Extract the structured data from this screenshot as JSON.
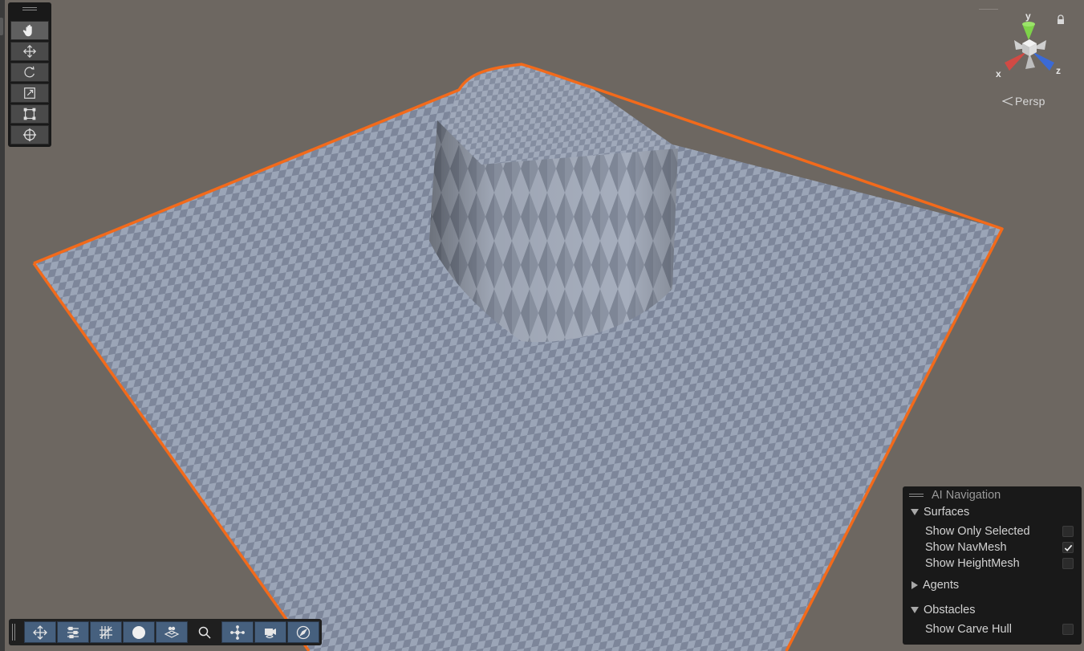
{
  "scene": {
    "view_mode": "Persp",
    "axis_labels": {
      "x": "x",
      "y": "y",
      "z": "z"
    }
  },
  "tools_toolbar": {
    "tools": [
      {
        "name": "view-tool",
        "icon": "hand-icon",
        "active": true
      },
      {
        "name": "move-tool",
        "icon": "move-icon"
      },
      {
        "name": "rotate-tool",
        "icon": "rotate-icon"
      },
      {
        "name": "scale-tool",
        "icon": "scale-icon"
      },
      {
        "name": "rect-tool",
        "icon": "rect-transform-icon"
      },
      {
        "name": "transform-tool",
        "icon": "transform-icon"
      }
    ]
  },
  "overlay_toolbar": {
    "buttons": [
      {
        "name": "tool-settings",
        "icon": "move-icon"
      },
      {
        "name": "scene-view-options",
        "icon": "sliders-icon"
      },
      {
        "name": "grid-snapping",
        "icon": "grid-snap-icon"
      },
      {
        "name": "draw-mode",
        "icon": "sphere-icon"
      },
      {
        "name": "orientation",
        "icon": "layers-icon"
      },
      {
        "name": "search",
        "icon": "search-icon"
      },
      {
        "name": "ai-navigation",
        "icon": "navmesh-icon"
      },
      {
        "name": "camera",
        "icon": "camera-icon"
      },
      {
        "name": "compass",
        "icon": "compass-icon"
      }
    ]
  },
  "ai_navigation": {
    "title": "AI Navigation",
    "surfaces": {
      "label": "Surfaces",
      "expanded": true,
      "options": [
        {
          "label": "Show Only Selected",
          "checked": false
        },
        {
          "label": "Show NavMesh",
          "checked": true
        },
        {
          "label": "Show HeightMesh",
          "checked": false
        }
      ]
    },
    "agents": {
      "label": "Agents",
      "expanded": false
    },
    "obstacles": {
      "label": "Obstacles",
      "expanded": true,
      "options": [
        {
          "label": "Show Carve Hull",
          "checked": false
        }
      ]
    }
  },
  "colors": {
    "background": "#6d6761",
    "selection_outline": "#f26a1b",
    "checker_light": "#9ca6b8",
    "checker_dark": "#7e879a",
    "panel_bg": "#191919",
    "button_blue": "#46607e"
  }
}
